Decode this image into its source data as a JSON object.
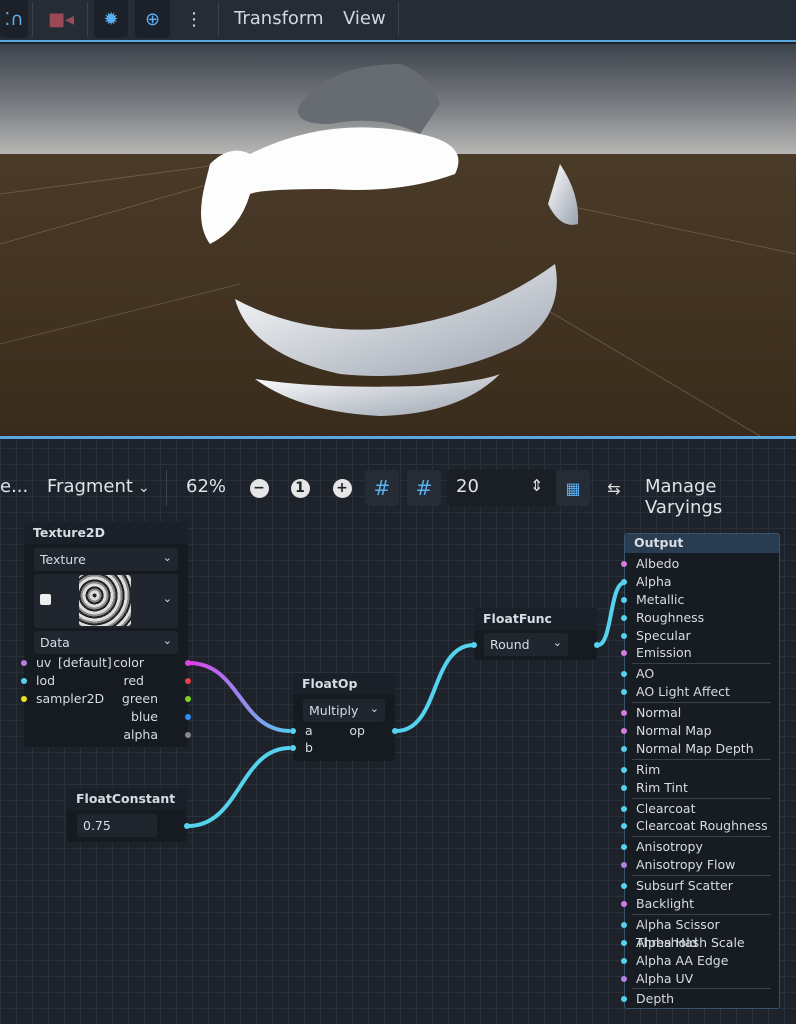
{
  "toolbar": {
    "menus": [
      "Transform",
      "View"
    ],
    "icons": [
      "snap-icon",
      "camera-icon",
      "sun-icon",
      "environment-icon",
      "more-icon"
    ]
  },
  "graph_toolbar": {
    "truncated": "e...",
    "shader_mode": "Fragment",
    "zoom": "62%",
    "snap_distance": "20",
    "manage_varyings": "Manage Varyings"
  },
  "nodes": {
    "texture2d": {
      "title": "Texture2D",
      "source": "Texture",
      "type": "Data",
      "inputs": [
        "uv",
        "lod",
        "sampler2D"
      ],
      "uv_default": "[default]",
      "outputs": [
        "color",
        "red",
        "green",
        "blue",
        "alpha"
      ]
    },
    "floatconstant": {
      "title": "FloatConstant",
      "value": "0.75"
    },
    "floatop": {
      "title": "FloatOp",
      "op": "Multiply",
      "inputs": [
        "a",
        "b"
      ],
      "output": "op"
    },
    "floatfunc": {
      "title": "FloatFunc",
      "func": "Round"
    },
    "output": {
      "title": "Output",
      "groups": [
        [
          {
            "l": "Albedo",
            "c": "#d67be0"
          },
          {
            "l": "Alpha",
            "c": "#55d3ee"
          },
          {
            "l": "Metallic",
            "c": "#55d3ee"
          },
          {
            "l": "Roughness",
            "c": "#55d3ee"
          },
          {
            "l": "Specular",
            "c": "#55d3ee"
          },
          {
            "l": "Emission",
            "c": "#d67be0"
          }
        ],
        [
          {
            "l": "AO",
            "c": "#55d3ee"
          },
          {
            "l": "AO Light Affect",
            "c": "#55d3ee"
          }
        ],
        [
          {
            "l": "Normal",
            "c": "#d67be0"
          },
          {
            "l": "Normal Map",
            "c": "#d67be0"
          },
          {
            "l": "Normal Map Depth",
            "c": "#55d3ee"
          }
        ],
        [
          {
            "l": "Rim",
            "c": "#55d3ee"
          },
          {
            "l": "Rim Tint",
            "c": "#55d3ee"
          }
        ],
        [
          {
            "l": "Clearcoat",
            "c": "#55d3ee"
          },
          {
            "l": "Clearcoat Roughness",
            "c": "#55d3ee"
          }
        ],
        [
          {
            "l": "Anisotropy",
            "c": "#55d3ee"
          },
          {
            "l": "Anisotropy Flow",
            "c": "#b083e0"
          }
        ],
        [
          {
            "l": "Subsurf Scatter",
            "c": "#55d3ee"
          },
          {
            "l": "Backlight",
            "c": "#d67be0"
          }
        ],
        [
          {
            "l": "Alpha Scissor Threshold",
            "c": "#55d3ee"
          },
          {
            "l": "Alpha Hash Scale",
            "c": "#55d3ee"
          },
          {
            "l": "Alpha AA Edge",
            "c": "#55d3ee"
          },
          {
            "l": "Alpha UV",
            "c": "#b083e0"
          }
        ],
        [
          {
            "l": "Depth",
            "c": "#55d3ee"
          }
        ]
      ]
    }
  },
  "colors": {
    "accent": "#5aa7e0",
    "wire_float": "#55d3ee",
    "wire_vec": "#e040e8"
  }
}
